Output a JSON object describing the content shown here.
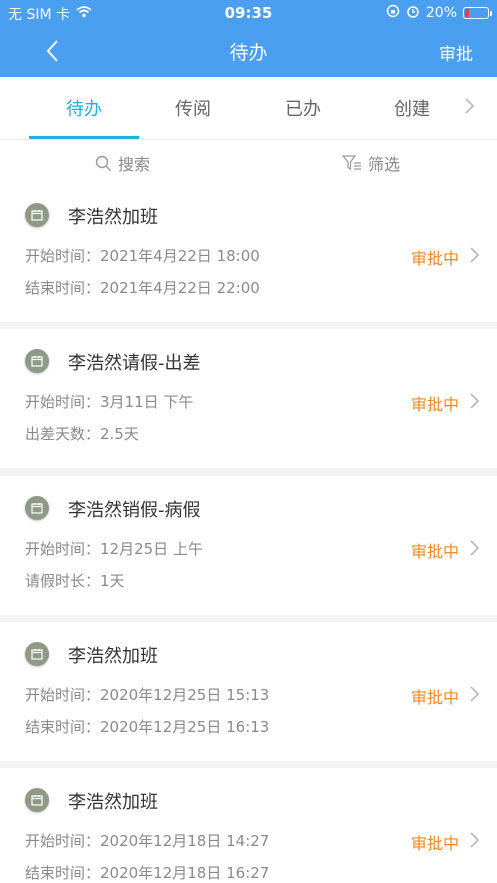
{
  "status_bar": {
    "carrier": "无 SIM 卡",
    "time": "09:35",
    "battery": "20%",
    "battery_level": 0.2
  },
  "nav": {
    "title": "待办",
    "action": "审批"
  },
  "tabs": [
    {
      "label": "待办",
      "active": true
    },
    {
      "label": "传阅",
      "active": false
    },
    {
      "label": "已办",
      "active": false
    },
    {
      "label": "创建",
      "active": false
    }
  ],
  "toolbar": {
    "search_label": "搜索",
    "filter_label": "筛选"
  },
  "items": [
    {
      "title": "李浩然加班",
      "line1": "开始时间：2021年4月22日 18:00",
      "line2": "结束时间：2021年4月22日 22:00",
      "status": "审批中"
    },
    {
      "title": "李浩然请假-出差",
      "line1": "开始时间：3月11日 下午",
      "line2": "出差天数：2.5天",
      "status": "审批中"
    },
    {
      "title": "李浩然销假-病假",
      "line1": "开始时间：12月25日 上午",
      "line2": "请假时长：1天",
      "status": "审批中"
    },
    {
      "title": "李浩然加班",
      "line1": "开始时间：2020年12月25日 15:13",
      "line2": "结束时间：2020年12月25日 16:13",
      "status": "审批中"
    },
    {
      "title": "李浩然加班",
      "line1": "开始时间：2020年12月18日 14:27",
      "line2": "结束时间：2020年12月18日 16:27",
      "status": "审批中"
    }
  ],
  "colors": {
    "header": "#4a9ff0",
    "accent": "#1eb4d8",
    "status": "#f5891f"
  }
}
